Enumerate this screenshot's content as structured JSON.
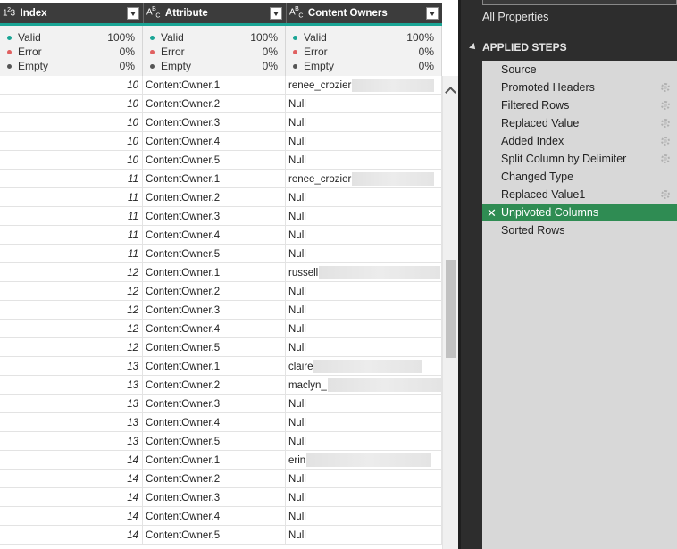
{
  "columns": [
    {
      "type_icon": "123",
      "label": "Index"
    },
    {
      "type_icon": "ABC",
      "label": "Attribute"
    },
    {
      "type_icon": "ABC",
      "label": "Content Owners"
    }
  ],
  "quality": {
    "labels": [
      "Valid",
      "Error",
      "Empty"
    ],
    "colors": [
      "#1aa595",
      "#e06060",
      "#555555"
    ],
    "values": [
      [
        "100%",
        "0%",
        "0%"
      ],
      [
        "100%",
        "0%",
        "0%"
      ],
      [
        "100%",
        "0%",
        "0%"
      ]
    ]
  },
  "rows": [
    {
      "index": "10",
      "attribute": "ContentOwner.1",
      "owner": "renee_crozier"
    },
    {
      "index": "10",
      "attribute": "ContentOwner.2",
      "owner": "Null"
    },
    {
      "index": "10",
      "attribute": "ContentOwner.3",
      "owner": "Null"
    },
    {
      "index": "10",
      "attribute": "ContentOwner.4",
      "owner": "Null"
    },
    {
      "index": "10",
      "attribute": "ContentOwner.5",
      "owner": "Null"
    },
    {
      "index": "11",
      "attribute": "ContentOwner.1",
      "owner": "renee_crozier"
    },
    {
      "index": "11",
      "attribute": "ContentOwner.2",
      "owner": "Null"
    },
    {
      "index": "11",
      "attribute": "ContentOwner.3",
      "owner": "Null"
    },
    {
      "index": "11",
      "attribute": "ContentOwner.4",
      "owner": "Null"
    },
    {
      "index": "11",
      "attribute": "ContentOwner.5",
      "owner": "Null"
    },
    {
      "index": "12",
      "attribute": "ContentOwner.1",
      "owner": "russell"
    },
    {
      "index": "12",
      "attribute": "ContentOwner.2",
      "owner": "Null"
    },
    {
      "index": "12",
      "attribute": "ContentOwner.3",
      "owner": "Null"
    },
    {
      "index": "12",
      "attribute": "ContentOwner.4",
      "owner": "Null"
    },
    {
      "index": "12",
      "attribute": "ContentOwner.5",
      "owner": "Null"
    },
    {
      "index": "13",
      "attribute": "ContentOwner.1",
      "owner": "claire"
    },
    {
      "index": "13",
      "attribute": "ContentOwner.2",
      "owner": "maclyn_"
    },
    {
      "index": "13",
      "attribute": "ContentOwner.3",
      "owner": "Null"
    },
    {
      "index": "13",
      "attribute": "ContentOwner.4",
      "owner": "Null"
    },
    {
      "index": "13",
      "attribute": "ContentOwner.5",
      "owner": "Null"
    },
    {
      "index": "14",
      "attribute": "ContentOwner.1",
      "owner": "erin"
    },
    {
      "index": "14",
      "attribute": "ContentOwner.2",
      "owner": "Null"
    },
    {
      "index": "14",
      "attribute": "ContentOwner.3",
      "owner": "Null"
    },
    {
      "index": "14",
      "attribute": "ContentOwner.4",
      "owner": "Null"
    },
    {
      "index": "14",
      "attribute": "ContentOwner.5",
      "owner": "Null"
    }
  ],
  "pane": {
    "all_properties": "All Properties",
    "applied_steps_title": "APPLIED STEPS",
    "steps": [
      {
        "label": "Source",
        "gear": false,
        "active": false
      },
      {
        "label": "Promoted Headers",
        "gear": true,
        "active": false
      },
      {
        "label": "Filtered Rows",
        "gear": true,
        "active": false
      },
      {
        "label": "Replaced Value",
        "gear": true,
        "active": false
      },
      {
        "label": "Added Index",
        "gear": true,
        "active": false
      },
      {
        "label": "Split Column by Delimiter",
        "gear": true,
        "active": false
      },
      {
        "label": "Changed Type",
        "gear": false,
        "active": false
      },
      {
        "label": "Replaced Value1",
        "gear": true,
        "active": false
      },
      {
        "label": "Unpivoted Columns",
        "gear": false,
        "active": true
      },
      {
        "label": "Sorted Rows",
        "gear": false,
        "active": false
      }
    ],
    "active_step_color": "#2f8c53"
  },
  "accent": "#1aa595"
}
